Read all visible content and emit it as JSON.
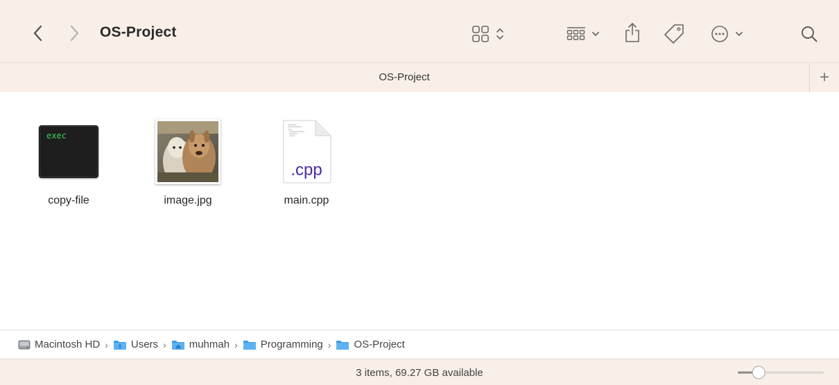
{
  "window": {
    "title": "OS-Project"
  },
  "tab": {
    "title": "OS-Project",
    "add_label": "+"
  },
  "files": [
    {
      "name": "copy-file",
      "kind": "exec",
      "icon_text": "exec"
    },
    {
      "name": "image.jpg",
      "kind": "image"
    },
    {
      "name": "main.cpp",
      "kind": "document",
      "icon_text": ".cpp"
    }
  ],
  "path": [
    {
      "label": "Macintosh HD",
      "icon": "hard-drive-icon"
    },
    {
      "label": "Users",
      "icon": "users-folder-icon"
    },
    {
      "label": "muhmah",
      "icon": "home-folder-icon"
    },
    {
      "label": "Programming",
      "icon": "folder-icon"
    },
    {
      "label": "OS-Project",
      "icon": "folder-icon"
    }
  ],
  "path_separator": "›",
  "status": {
    "text": "3 items, 69.27 GB available"
  },
  "zoom": {
    "level": 0.2
  },
  "colors": {
    "toolbar_bg": "#f7efe8",
    "folder_blue": "#3d9be9",
    "cpp_text": "#4b2ba3",
    "exec_text": "#3ed15a"
  }
}
